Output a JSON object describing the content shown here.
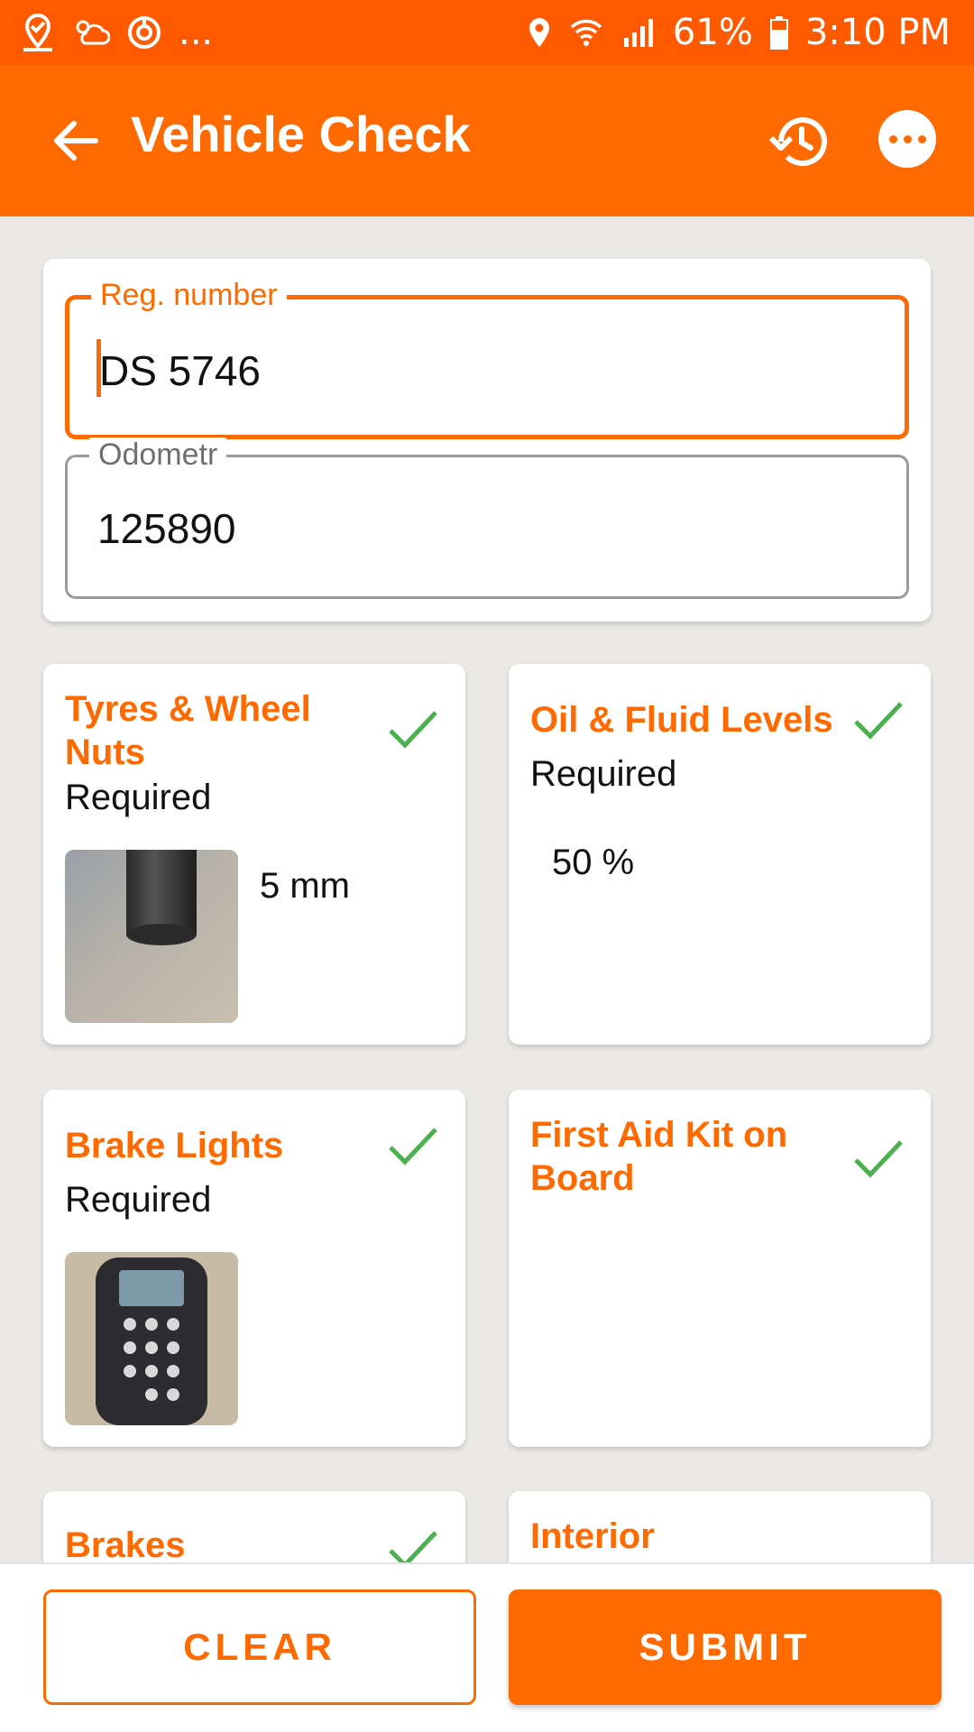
{
  "status_bar": {
    "notification_icons": [
      "location-check-icon",
      "weather-icon",
      "sync-icon"
    ],
    "more_notifications": "...",
    "system_icons": [
      "location-pin-icon",
      "wifi-icon",
      "signal-icon",
      "battery-icon"
    ],
    "battery": "61%",
    "time": "3:10 PM"
  },
  "app_bar": {
    "title": "Vehicle Check",
    "back_icon": "arrow-back-icon",
    "history_icon": "history-icon",
    "more_icon": "more-horizontal-icon"
  },
  "form": {
    "reg_number": {
      "label": "Reg. number",
      "value": "DS 5746",
      "focused": true
    },
    "odometer": {
      "label": "Odometr",
      "value": "125890"
    }
  },
  "checks": [
    {
      "title": "Tyres & Wheel Nuts",
      "subtitle": "Required",
      "value": "5 mm",
      "checked": true,
      "photo": "tyre-photo"
    },
    {
      "title": "Oil & Fluid Levels",
      "subtitle": "Required",
      "value": "50 %",
      "checked": true
    },
    {
      "title": "Brake Lights",
      "subtitle": "Required",
      "checked": true,
      "photo": "remote-control-photo"
    },
    {
      "title": "First Aid Kit on Board",
      "checked": true
    },
    {
      "title": "Brakes",
      "checked": true
    },
    {
      "title": "Interior"
    }
  ],
  "actions": {
    "clear_label": "CLEAR",
    "submit_label": "SUBMIT"
  },
  "colors": {
    "status_bar": "#ff5a00",
    "primary": "#ff6a00",
    "check": "#4caf50",
    "background": "#ebe9e6"
  }
}
